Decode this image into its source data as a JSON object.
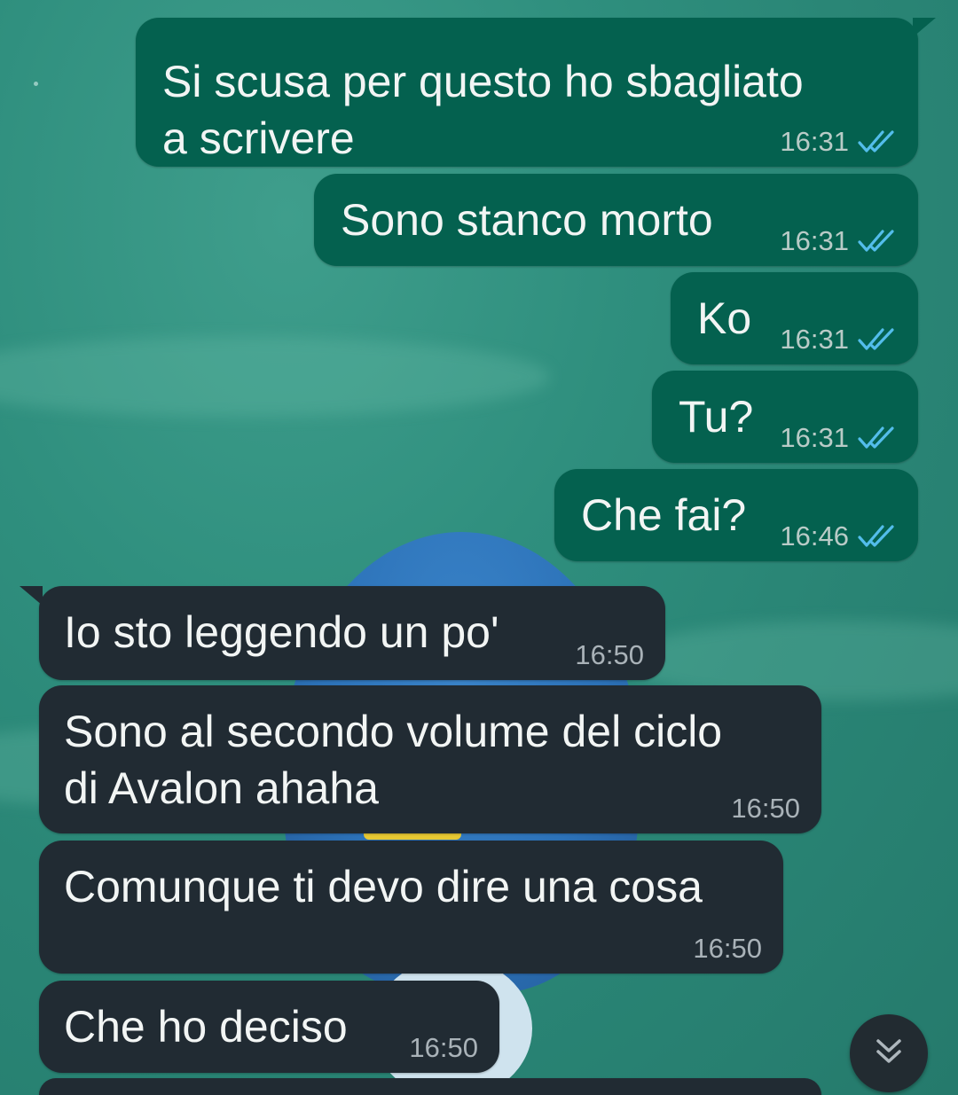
{
  "colors": {
    "outgoing_bubble": "#04614f",
    "incoming_bubble": "#212b33",
    "read_ticks": "#53bdeb"
  },
  "messages": [
    {
      "direction": "outgoing",
      "lines": [
        "Si scusa per questo ho sbagliato",
        "a scrivere"
      ],
      "time": "16:31",
      "status": "read"
    },
    {
      "direction": "outgoing",
      "lines": [
        "Sono stanco morto"
      ],
      "time": "16:31",
      "status": "read"
    },
    {
      "direction": "outgoing",
      "lines": [
        "Ko"
      ],
      "time": "16:31",
      "status": "read"
    },
    {
      "direction": "outgoing",
      "lines": [
        "Tu?"
      ],
      "time": "16:31",
      "status": "read"
    },
    {
      "direction": "outgoing",
      "lines": [
        "Che fai?"
      ],
      "time": "16:46",
      "status": "read"
    },
    {
      "direction": "incoming",
      "lines": [
        "Io sto leggendo un po'"
      ],
      "time": "16:50"
    },
    {
      "direction": "incoming",
      "lines": [
        "Sono al secondo volume del ciclo",
        "di Avalon ahaha"
      ],
      "time": "16:50"
    },
    {
      "direction": "incoming",
      "lines": [
        "Comunque ti devo dire una cosa"
      ],
      "time": "16:50"
    },
    {
      "direction": "incoming",
      "lines": [
        "Che ho deciso"
      ],
      "time": "16:50"
    }
  ],
  "scroll_down_button": {
    "icon": "double-chevron-down-icon"
  }
}
